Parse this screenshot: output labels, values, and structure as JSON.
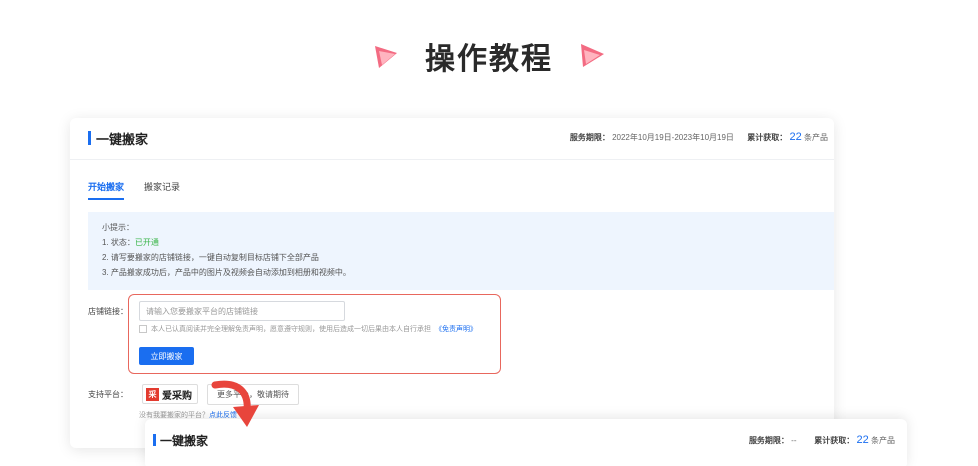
{
  "heading": {
    "title": "操作教程"
  },
  "card": {
    "title": "一键搬家",
    "service_label": "服务期限：",
    "service_period": "2022年10月19日-2023年10月19日",
    "obtained_label": "累计获取：",
    "obtained_count": "22",
    "obtained_unit": "条产品"
  },
  "tabs": [
    {
      "label": "开始搬家",
      "active": true
    },
    {
      "label": "搬家记录",
      "active": false
    }
  ],
  "tips": {
    "title": "小提示：",
    "status_prefix": "1. 状态：",
    "status_value": "已开通",
    "line2": "2. 请写要搬家的店铺链接，一键自动复制目标店铺下全部产品",
    "line3": "3. 产品搬家成功后，产品中的图片及视频会自动添加到相册和视频中。"
  },
  "form": {
    "label": "店铺链接：",
    "placeholder": "请输入您要搬家平台的店铺链接",
    "value": "",
    "agree_text": "本人已认真阅读并完全理解免责声明，愿意遵守规则，使用后造成一切后果由本人自行承担",
    "agree_link": "《免责声明》",
    "submit_label": "立即搬家"
  },
  "platforms": {
    "label": "支持平台：",
    "logo_mark": "采",
    "logo_name": "爱采购",
    "more": "更多平台，敬请期待",
    "no_platform": "没有我要搬家的平台？",
    "no_platform_link": "点此反馈"
  },
  "card2": {
    "title": "一键搬家",
    "service_label": "服务期限：",
    "service_value": "--",
    "obtained_label": "累计获取：",
    "obtained_count": "22",
    "obtained_unit": "条产品"
  },
  "colors": {
    "accent": "#1a6ef0",
    "highlight_border": "#e8675d",
    "arrow": "#e8453c",
    "success": "#3ab549",
    "tips_bg": "#eef5fe"
  },
  "icons": {
    "left_decoration": "play-triangle-icon",
    "right_decoration": "play-triangle-icon",
    "arrow": "curved-arrow-icon",
    "checkbox": "checkbox-icon"
  }
}
